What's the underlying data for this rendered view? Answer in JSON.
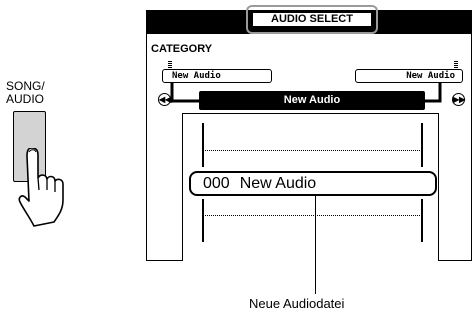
{
  "panel_button": {
    "label_line1": "SONG/",
    "label_line2": "AUDIO",
    "icon": "hand-press-icon"
  },
  "lcd": {
    "title": "AUDIO SELECT",
    "category_label": "CATEGORY",
    "category_left": "New Audio",
    "category_right": "New Audio",
    "prev_icon": "rewind-icon",
    "next_icon": "fast-forward-icon",
    "current_name": "New Audio",
    "selected_item": {
      "number": "000",
      "name": "New Audio"
    }
  },
  "callout": {
    "label": "Neue Audiodatei"
  },
  "colors": {
    "highlight_frame": "#9a9a9a",
    "button_fill": "#d3d3d3",
    "lcd_bar": "#000000"
  }
}
